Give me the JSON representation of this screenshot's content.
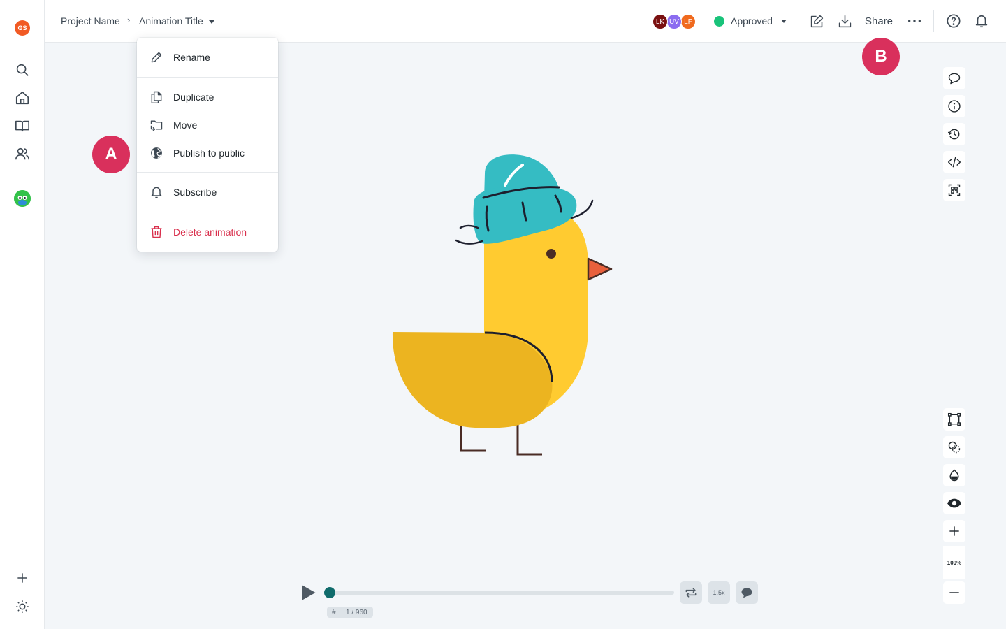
{
  "rail": {
    "user_initials": "GS",
    "icons": [
      "search-icon",
      "home-icon",
      "book-icon",
      "team-icon",
      "add-icon",
      "theme-icon"
    ]
  },
  "breadcrumb": {
    "project": "Project Name",
    "separator": "›",
    "title": "Animation Title"
  },
  "collaborators": [
    {
      "initials": "LK",
      "color": "#7a1010"
    },
    {
      "initials": "UV",
      "color": "#8b6cf0"
    },
    {
      "initials": "LF",
      "color": "#f06a1e"
    }
  ],
  "status": {
    "label": "Approved",
    "color": "#19c37a"
  },
  "topbar": {
    "share_label": "Share"
  },
  "menu": {
    "items": [
      {
        "label": "Rename",
        "icon": "pencil-icon"
      },
      {
        "label": "Duplicate",
        "icon": "duplicate-icon"
      },
      {
        "label": "Move",
        "icon": "move-folder-icon"
      },
      {
        "label": "Publish to public",
        "icon": "globe-icon"
      },
      {
        "label": "Subscribe",
        "icon": "bell-icon"
      },
      {
        "label": "Delete animation",
        "icon": "trash-icon",
        "danger": true
      }
    ]
  },
  "markers": {
    "a": "A",
    "b": "B"
  },
  "right_toolbar": {
    "top": [
      "comment-icon",
      "info-icon",
      "history-icon",
      "code-icon",
      "qr-icon"
    ],
    "bottom": [
      "bounding-box-icon",
      "blend-icon",
      "color-drop-icon",
      "eye-icon",
      "zoom-in-icon",
      "zoom-out-icon"
    ],
    "zoom": "100%"
  },
  "player": {
    "speed": "1.5x",
    "frame_hash": "#",
    "frame": "1 / 960",
    "progress": 0.0
  },
  "colors": {
    "accent": "#0f6b6b",
    "marker": "#d9305c",
    "danger": "#d9304d",
    "duck_body": "#ffcb30",
    "duck_wing": "#ecb420",
    "hat": "#35bcc3",
    "beak": "#e8603c"
  }
}
